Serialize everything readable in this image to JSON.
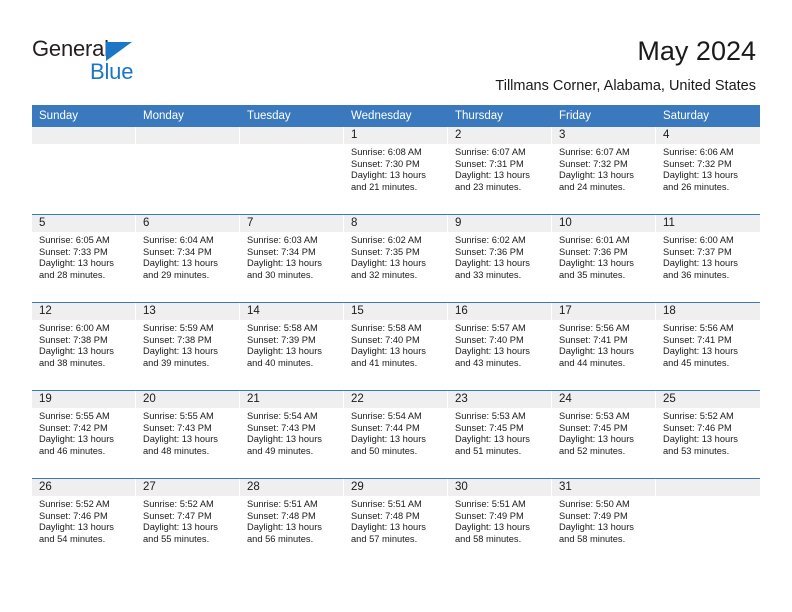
{
  "brand": {
    "name_top": "General",
    "name_bottom": "Blue",
    "triangle_icon": "brand-triangle-icon",
    "accent_color": "#1b77c6"
  },
  "header": {
    "title": "May 2024",
    "subtitle": "Tillmans Corner, Alabama, United States",
    "header_bg_color": "#3a79bd",
    "daynum_bg_color": "#efefef"
  },
  "weekdays": [
    "Sunday",
    "Monday",
    "Tuesday",
    "Wednesday",
    "Thursday",
    "Friday",
    "Saturday"
  ],
  "weeks": [
    [
      {
        "day": "",
        "empty": true,
        "sunrise": "",
        "sunset": "",
        "daylight_line1": "",
        "daylight_line2": ""
      },
      {
        "day": "",
        "empty": true,
        "sunrise": "",
        "sunset": "",
        "daylight_line1": "",
        "daylight_line2": ""
      },
      {
        "day": "",
        "empty": true,
        "sunrise": "",
        "sunset": "",
        "daylight_line1": "",
        "daylight_line2": ""
      },
      {
        "day": "1",
        "empty": false,
        "sunrise": "Sunrise: 6:08 AM",
        "sunset": "Sunset: 7:30 PM",
        "daylight_line1": "Daylight: 13 hours",
        "daylight_line2": "and 21 minutes."
      },
      {
        "day": "2",
        "empty": false,
        "sunrise": "Sunrise: 6:07 AM",
        "sunset": "Sunset: 7:31 PM",
        "daylight_line1": "Daylight: 13 hours",
        "daylight_line2": "and 23 minutes."
      },
      {
        "day": "3",
        "empty": false,
        "sunrise": "Sunrise: 6:07 AM",
        "sunset": "Sunset: 7:32 PM",
        "daylight_line1": "Daylight: 13 hours",
        "daylight_line2": "and 24 minutes."
      },
      {
        "day": "4",
        "empty": false,
        "sunrise": "Sunrise: 6:06 AM",
        "sunset": "Sunset: 7:32 PM",
        "daylight_line1": "Daylight: 13 hours",
        "daylight_line2": "and 26 minutes."
      }
    ],
    [
      {
        "day": "5",
        "empty": false,
        "sunrise": "Sunrise: 6:05 AM",
        "sunset": "Sunset: 7:33 PM",
        "daylight_line1": "Daylight: 13 hours",
        "daylight_line2": "and 28 minutes."
      },
      {
        "day": "6",
        "empty": false,
        "sunrise": "Sunrise: 6:04 AM",
        "sunset": "Sunset: 7:34 PM",
        "daylight_line1": "Daylight: 13 hours",
        "daylight_line2": "and 29 minutes."
      },
      {
        "day": "7",
        "empty": false,
        "sunrise": "Sunrise: 6:03 AM",
        "sunset": "Sunset: 7:34 PM",
        "daylight_line1": "Daylight: 13 hours",
        "daylight_line2": "and 30 minutes."
      },
      {
        "day": "8",
        "empty": false,
        "sunrise": "Sunrise: 6:02 AM",
        "sunset": "Sunset: 7:35 PM",
        "daylight_line1": "Daylight: 13 hours",
        "daylight_line2": "and 32 minutes."
      },
      {
        "day": "9",
        "empty": false,
        "sunrise": "Sunrise: 6:02 AM",
        "sunset": "Sunset: 7:36 PM",
        "daylight_line1": "Daylight: 13 hours",
        "daylight_line2": "and 33 minutes."
      },
      {
        "day": "10",
        "empty": false,
        "sunrise": "Sunrise: 6:01 AM",
        "sunset": "Sunset: 7:36 PM",
        "daylight_line1": "Daylight: 13 hours",
        "daylight_line2": "and 35 minutes."
      },
      {
        "day": "11",
        "empty": false,
        "sunrise": "Sunrise: 6:00 AM",
        "sunset": "Sunset: 7:37 PM",
        "daylight_line1": "Daylight: 13 hours",
        "daylight_line2": "and 36 minutes."
      }
    ],
    [
      {
        "day": "12",
        "empty": false,
        "sunrise": "Sunrise: 6:00 AM",
        "sunset": "Sunset: 7:38 PM",
        "daylight_line1": "Daylight: 13 hours",
        "daylight_line2": "and 38 minutes."
      },
      {
        "day": "13",
        "empty": false,
        "sunrise": "Sunrise: 5:59 AM",
        "sunset": "Sunset: 7:38 PM",
        "daylight_line1": "Daylight: 13 hours",
        "daylight_line2": "and 39 minutes."
      },
      {
        "day": "14",
        "empty": false,
        "sunrise": "Sunrise: 5:58 AM",
        "sunset": "Sunset: 7:39 PM",
        "daylight_line1": "Daylight: 13 hours",
        "daylight_line2": "and 40 minutes."
      },
      {
        "day": "15",
        "empty": false,
        "sunrise": "Sunrise: 5:58 AM",
        "sunset": "Sunset: 7:40 PM",
        "daylight_line1": "Daylight: 13 hours",
        "daylight_line2": "and 41 minutes."
      },
      {
        "day": "16",
        "empty": false,
        "sunrise": "Sunrise: 5:57 AM",
        "sunset": "Sunset: 7:40 PM",
        "daylight_line1": "Daylight: 13 hours",
        "daylight_line2": "and 43 minutes."
      },
      {
        "day": "17",
        "empty": false,
        "sunrise": "Sunrise: 5:56 AM",
        "sunset": "Sunset: 7:41 PM",
        "daylight_line1": "Daylight: 13 hours",
        "daylight_line2": "and 44 minutes."
      },
      {
        "day": "18",
        "empty": false,
        "sunrise": "Sunrise: 5:56 AM",
        "sunset": "Sunset: 7:41 PM",
        "daylight_line1": "Daylight: 13 hours",
        "daylight_line2": "and 45 minutes."
      }
    ],
    [
      {
        "day": "19",
        "empty": false,
        "sunrise": "Sunrise: 5:55 AM",
        "sunset": "Sunset: 7:42 PM",
        "daylight_line1": "Daylight: 13 hours",
        "daylight_line2": "and 46 minutes."
      },
      {
        "day": "20",
        "empty": false,
        "sunrise": "Sunrise: 5:55 AM",
        "sunset": "Sunset: 7:43 PM",
        "daylight_line1": "Daylight: 13 hours",
        "daylight_line2": "and 48 minutes."
      },
      {
        "day": "21",
        "empty": false,
        "sunrise": "Sunrise: 5:54 AM",
        "sunset": "Sunset: 7:43 PM",
        "daylight_line1": "Daylight: 13 hours",
        "daylight_line2": "and 49 minutes."
      },
      {
        "day": "22",
        "empty": false,
        "sunrise": "Sunrise: 5:54 AM",
        "sunset": "Sunset: 7:44 PM",
        "daylight_line1": "Daylight: 13 hours",
        "daylight_line2": "and 50 minutes."
      },
      {
        "day": "23",
        "empty": false,
        "sunrise": "Sunrise: 5:53 AM",
        "sunset": "Sunset: 7:45 PM",
        "daylight_line1": "Daylight: 13 hours",
        "daylight_line2": "and 51 minutes."
      },
      {
        "day": "24",
        "empty": false,
        "sunrise": "Sunrise: 5:53 AM",
        "sunset": "Sunset: 7:45 PM",
        "daylight_line1": "Daylight: 13 hours",
        "daylight_line2": "and 52 minutes."
      },
      {
        "day": "25",
        "empty": false,
        "sunrise": "Sunrise: 5:52 AM",
        "sunset": "Sunset: 7:46 PM",
        "daylight_line1": "Daylight: 13 hours",
        "daylight_line2": "and 53 minutes."
      }
    ],
    [
      {
        "day": "26",
        "empty": false,
        "sunrise": "Sunrise: 5:52 AM",
        "sunset": "Sunset: 7:46 PM",
        "daylight_line1": "Daylight: 13 hours",
        "daylight_line2": "and 54 minutes."
      },
      {
        "day": "27",
        "empty": false,
        "sunrise": "Sunrise: 5:52 AM",
        "sunset": "Sunset: 7:47 PM",
        "daylight_line1": "Daylight: 13 hours",
        "daylight_line2": "and 55 minutes."
      },
      {
        "day": "28",
        "empty": false,
        "sunrise": "Sunrise: 5:51 AM",
        "sunset": "Sunset: 7:48 PM",
        "daylight_line1": "Daylight: 13 hours",
        "daylight_line2": "and 56 minutes."
      },
      {
        "day": "29",
        "empty": false,
        "sunrise": "Sunrise: 5:51 AM",
        "sunset": "Sunset: 7:48 PM",
        "daylight_line1": "Daylight: 13 hours",
        "daylight_line2": "and 57 minutes."
      },
      {
        "day": "30",
        "empty": false,
        "sunrise": "Sunrise: 5:51 AM",
        "sunset": "Sunset: 7:49 PM",
        "daylight_line1": "Daylight: 13 hours",
        "daylight_line2": "and 58 minutes."
      },
      {
        "day": "31",
        "empty": false,
        "sunrise": "Sunrise: 5:50 AM",
        "sunset": "Sunset: 7:49 PM",
        "daylight_line1": "Daylight: 13 hours",
        "daylight_line2": "and 58 minutes."
      },
      {
        "day": "",
        "empty": true,
        "sunrise": "",
        "sunset": "",
        "daylight_line1": "",
        "daylight_line2": ""
      }
    ]
  ]
}
